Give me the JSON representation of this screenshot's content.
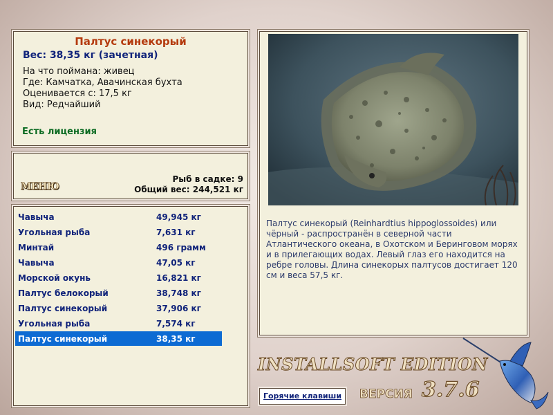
{
  "fish_info": {
    "name": "Палтус синекорый",
    "weight": "Вес: 38,35 кг (зачетная)",
    "caught_on": "На что поймана: живец",
    "location": "Где: Камчатка, Авачинская бухта",
    "valued_from": "Оценивается с: 17,5 кг",
    "rarity": "Вид: Редчайший",
    "license": "Есть лицензия"
  },
  "menu": {
    "button": "МЕНЮ",
    "fish_in_cage": "Рыб в садке: 9",
    "total_weight": "Общий вес: 244,521 кг"
  },
  "catch_list": [
    {
      "name": "Чавыча",
      "weight": "49,945 кг"
    },
    {
      "name": "Угольная рыба",
      "weight": "7,631 кг"
    },
    {
      "name": "Минтай",
      "weight": "496 грамм"
    },
    {
      "name": "Чавыча",
      "weight": "47,05 кг"
    },
    {
      "name": "Морской окунь",
      "weight": "16,821 кг"
    },
    {
      "name": "Палтус белокорый",
      "weight": "38,748 кг"
    },
    {
      "name": "Палтус синекорый",
      "weight": "37,906 кг"
    },
    {
      "name": "Угольная рыба",
      "weight": "7,574 кг"
    },
    {
      "name": "Палтус синекорый",
      "weight": "38,35 кг"
    }
  ],
  "selected_index": 8,
  "description": "Палтус синекорый (Reinhardtius hippoglossoides) или чёрный - распространён в северной части Атлантического океана, в Охотском и Беринговом морях и в прилегающих водах. Левый глаз его находится на ребре головы. Длина синекорых палтусов достигает 120 см и веса 57,5 кг.",
  "footer": {
    "hotkeys": "Горячие клавиши",
    "brand": "INSTALLSOFT EDITION",
    "version_label": "ВЕРСИЯ",
    "version": "3.7.6"
  },
  "colors": {
    "panel_bg": "#f3f0dd",
    "fish_title": "#b43a0e",
    "list_text": "#10237a",
    "selection": "#0d6bd3",
    "license": "#0b6b22"
  }
}
